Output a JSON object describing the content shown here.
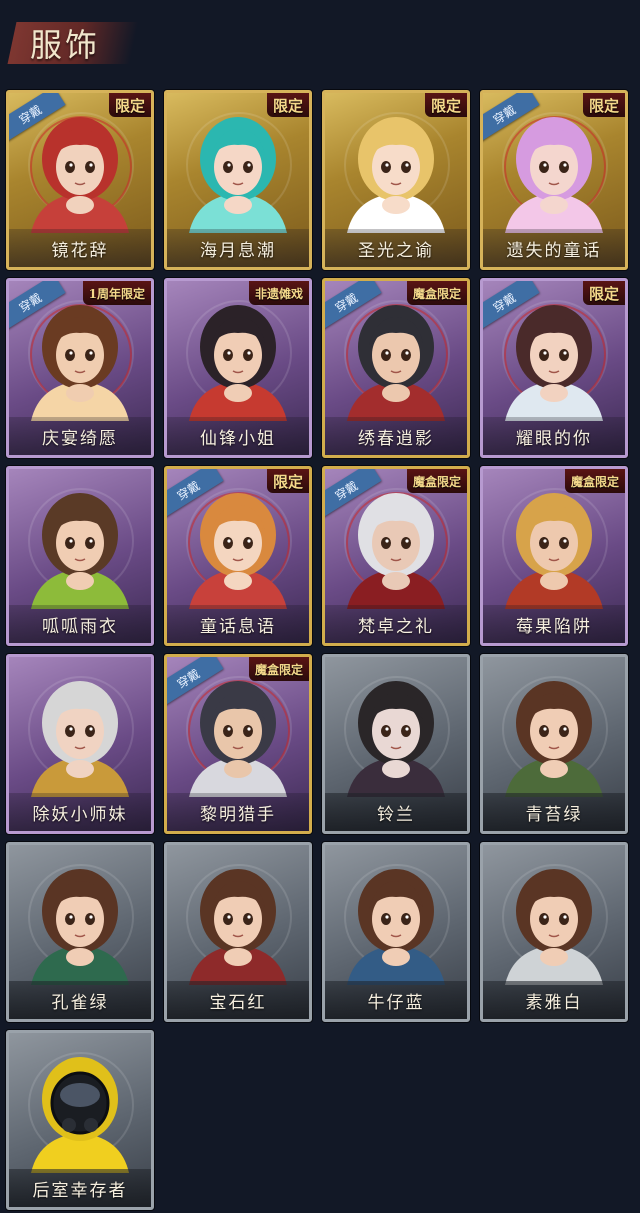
{
  "header": {
    "title": "服饰"
  },
  "cards": [
    {
      "name": "镜花辞",
      "style": "gold",
      "worn": true,
      "tag": "限定",
      "hair": "#b8322c",
      "skin": "#f1d2bd",
      "accent": "#c6403a"
    },
    {
      "name": "海月息潮",
      "style": "gold",
      "worn": false,
      "tag": "限定",
      "hair": "#2bb7b0",
      "skin": "#f5d7c6",
      "accent": "#7be0d6"
    },
    {
      "name": "圣光之谕",
      "style": "gold",
      "worn": false,
      "tag": "限定",
      "hair": "#e8c46a",
      "skin": "#f7dcc9",
      "accent": "#ffffff"
    },
    {
      "name": "遗失的童话",
      "style": "gold",
      "worn": true,
      "tag": "限定",
      "hair": "#d69be0",
      "skin": "#f4d6ce",
      "accent": "#f3c7e8"
    },
    {
      "name": "庆宴绮愿",
      "style": "purple",
      "worn": true,
      "tag": "1周年限定",
      "hair": "#6a3b22",
      "skin": "#f0cdb0",
      "accent": "#f5d5a6"
    },
    {
      "name": "仙锋小姐",
      "style": "purple",
      "worn": false,
      "tag": "非遗傩戏",
      "hair": "#2b2228",
      "skin": "#f0cdb5",
      "accent": "#c63a30"
    },
    {
      "name": "绣春逍影",
      "style": "pgold",
      "worn": true,
      "tag": "魔盒限定",
      "hair": "#2f2f36",
      "skin": "#ecc8ae",
      "accent": "#a32d2d"
    },
    {
      "name": "耀眼的你",
      "style": "purple",
      "worn": true,
      "tag": "限定",
      "hair": "#4a2a2a",
      "skin": "#f2d2c0",
      "accent": "#dfe8f0"
    },
    {
      "name": "呱呱雨衣",
      "style": "purple",
      "worn": false,
      "tag": "",
      "hair": "#5a3a26",
      "skin": "#f0cdb3",
      "accent": "#8dbb3a"
    },
    {
      "name": "童话息语",
      "style": "pgold",
      "worn": true,
      "tag": "限定",
      "hair": "#d9893e",
      "skin": "#f4d6c0",
      "accent": "#c8413b"
    },
    {
      "name": "梵卓之礼",
      "style": "pgold",
      "worn": true,
      "tag": "魔盒限定",
      "hair": "#e0e0e4",
      "skin": "#e9c9b6",
      "accent": "#8a1e22"
    },
    {
      "name": "莓果陷阱",
      "style": "purple",
      "worn": false,
      "tag": "魔盒限定",
      "hair": "#d7a34a",
      "skin": "#eec9ae",
      "accent": "#b23a26"
    },
    {
      "name": "除妖小师妹",
      "style": "purple",
      "worn": false,
      "tag": "",
      "hair": "#d6d6d6",
      "skin": "#f0d3c2",
      "accent": "#c99a3a"
    },
    {
      "name": "黎明猎手",
      "style": "pgold",
      "worn": true,
      "tag": "魔盒限定",
      "hair": "#3a3a46",
      "skin": "#e9c6aa",
      "accent": "#d8d8de"
    },
    {
      "name": "铃兰",
      "style": "gray",
      "worn": false,
      "tag": "",
      "hair": "#2a2628",
      "skin": "#e9d8d4",
      "accent": "#3a2d3c"
    },
    {
      "name": "青苔绿",
      "style": "gray",
      "worn": false,
      "tag": "",
      "hair": "#5a3524",
      "skin": "#f0cdb5",
      "accent": "#4d6b3a"
    },
    {
      "name": "孔雀绿",
      "style": "gray",
      "worn": false,
      "tag": "",
      "hair": "#5a3524",
      "skin": "#f0cdb5",
      "accent": "#2e6a4e"
    },
    {
      "name": "宝石红",
      "style": "gray",
      "worn": false,
      "tag": "",
      "hair": "#5a3524",
      "skin": "#f0cdb5",
      "accent": "#8e2a2a"
    },
    {
      "name": "牛仔蓝",
      "style": "gray",
      "worn": false,
      "tag": "",
      "hair": "#5a3524",
      "skin": "#f0cdb5",
      "accent": "#335c86"
    },
    {
      "name": "素雅白",
      "style": "gray",
      "worn": false,
      "tag": "",
      "hair": "#5a3524",
      "skin": "#f0cdb5",
      "accent": "#cfd3d6"
    },
    {
      "name": "后室幸存者",
      "style": "gray",
      "worn": false,
      "tag": "",
      "hair": "#e0c01a",
      "skin": "#20242a",
      "accent": "#f0cf1f"
    }
  ],
  "wear_label": "穿戴"
}
